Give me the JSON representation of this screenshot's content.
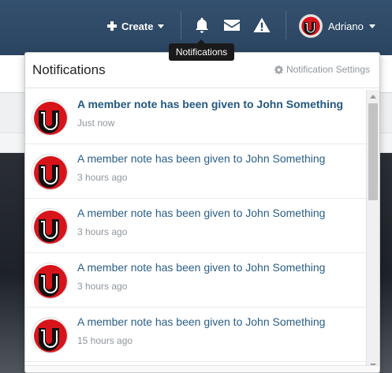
{
  "nav": {
    "create_label": "Create",
    "username": "Adriano",
    "icons": [
      "bell-icon",
      "envelope-icon",
      "warning-icon"
    ]
  },
  "tooltip": {
    "text": "Notifications"
  },
  "panel": {
    "title": "Notifications",
    "settings_label": "Notification Settings"
  },
  "notifications": [
    {
      "text": "A member note has been given to John Something",
      "time": "Just now",
      "unread": true
    },
    {
      "text": "A member note has been given to John Something",
      "time": "3 hours ago",
      "unread": false
    },
    {
      "text": "A member note has been given to John Something",
      "time": "3 hours ago",
      "unread": false
    },
    {
      "text": "A member note has been given to John Something",
      "time": "3 hours ago",
      "unread": false
    },
    {
      "text": "A member note has been given to John Something",
      "time": "15 hours ago",
      "unread": false
    }
  ],
  "colors": {
    "header": "#2f4b68",
    "link": "#2a5e86",
    "muted": "#8f969c",
    "logo_red": "#d8141b"
  }
}
